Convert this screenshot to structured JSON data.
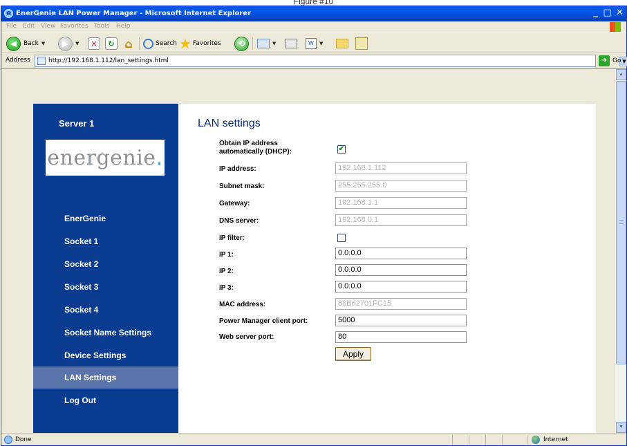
{
  "caption": "Figure #10",
  "window": {
    "title": "EnerGenie LAN Power Manager - Microsoft Internet Explorer"
  },
  "menu": [
    "File",
    "Edit",
    "View",
    "Favorites",
    "Tools",
    "Help"
  ],
  "toolbar": {
    "back_label": "Back",
    "search_label": "Search",
    "favorites_label": "Favorites"
  },
  "address": {
    "label": "Address",
    "url": "http://192.168.1.112/lan_settings.html",
    "go_label": "Go"
  },
  "sidebar": {
    "server_title": "Server 1",
    "logo": "energenie",
    "items": [
      {
        "label": "EnerGenie",
        "active": false
      },
      {
        "label": "Socket 1",
        "active": false
      },
      {
        "label": "Socket 2",
        "active": false
      },
      {
        "label": "Socket 3",
        "active": false
      },
      {
        "label": "Socket 4",
        "active": false
      },
      {
        "label": "Socket Name Settings",
        "active": false
      },
      {
        "label": "Device Settings",
        "active": false
      },
      {
        "label": "LAN Settings",
        "active": true
      },
      {
        "label": "Log Out",
        "active": false
      }
    ]
  },
  "form": {
    "title": "LAN settings",
    "dhcp_label": "Obtain IP address automatically (DHCP):",
    "dhcp_checked": true,
    "ip_address_label": "IP address:",
    "ip_address": "192.168.1.112",
    "subnet_label": "Subnet mask:",
    "subnet": "255.255.255.0",
    "gateway_label": "Gateway:",
    "gateway": "192.168.1.1",
    "dns_label": "DNS server:",
    "dns": "192.168.0.1",
    "ip_filter_label": "IP filter:",
    "ip_filter_checked": false,
    "ip1_label": "IP 1:",
    "ip1": "0.0.0.0",
    "ip2_label": "IP 2:",
    "ip2": "0.0.0.0",
    "ip3_label": "IP 3:",
    "ip3": "0.0.0.0",
    "mac_label": "MAC address:",
    "mac": "88B62701FC15",
    "client_port_label": "Power Manager client port:",
    "client_port": "5000",
    "web_port_label": "Web server port:",
    "web_port": "80",
    "apply_label": "Apply"
  },
  "status": {
    "text": "Done",
    "zone": "Internet"
  },
  "colors": {
    "sidebar_bg": "#0a3d91",
    "sidebar_active_bg": "#5a73a8",
    "title_color": "#0a2d70",
    "xp_titlebar": "#0058ee"
  }
}
